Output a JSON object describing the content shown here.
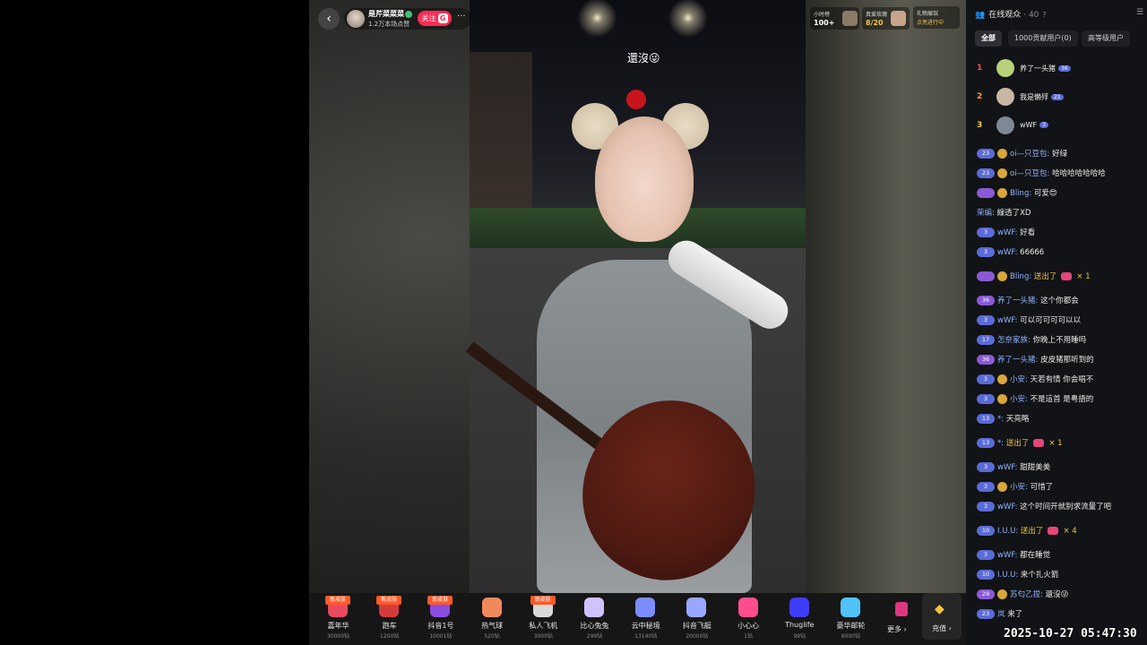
{
  "host": {
    "name": "是芹菜菜菜",
    "subtitle": "1.2万本场点赞",
    "follow_label": "关注",
    "follow_badge": "G",
    "more": "···",
    "back": "‹"
  },
  "video": {
    "sign_text": "還沒😜"
  },
  "top_rank": {
    "hour_label": "小时榜",
    "hour_value": "100+",
    "fan_label": "真爱玫瑰",
    "fan_value": "8/20",
    "gift_label": "礼物展馆",
    "gift_status": "点亮进行中"
  },
  "gifts": [
    {
      "badge": "新皮肤",
      "name": "嘉年华",
      "price": "30000钻",
      "color": "#e84a5f"
    },
    {
      "badge": "新皮肤",
      "name": "跑车",
      "price": "1200钻",
      "color": "#d43c3c"
    },
    {
      "badge": "新皮肤",
      "name": "抖音1号",
      "price": "10001钻",
      "color": "#8a4de0"
    },
    {
      "badge": "",
      "name": "热气球",
      "price": "520钻",
      "color": "#f08a5d"
    },
    {
      "badge": "新皮肤",
      "name": "私人飞机",
      "price": "3000钻",
      "color": "#d9d9d9"
    },
    {
      "badge": "",
      "name": "比心兔兔",
      "price": "299钻",
      "color": "#cfc2ff"
    },
    {
      "badge": "",
      "name": "云中秘境",
      "price": "13140钻",
      "color": "#7d8cff"
    },
    {
      "badge": "",
      "name": "抖音飞艇",
      "price": "20000钻",
      "color": "#9aa7ff"
    },
    {
      "badge": "",
      "name": "小心心",
      "price": "1钻",
      "color": "#ff4d8d"
    },
    {
      "badge": "",
      "name": "Thuglife",
      "price": "99钻",
      "color": "#3d3dff"
    },
    {
      "badge": "",
      "name": "豪华邮轮",
      "price": "6000钻",
      "color": "#4fc3f7"
    }
  ],
  "gift_more_label": "更多 ›",
  "recharge_label": "充值 ›",
  "panel": {
    "title": "在线观众",
    "count": "· 40",
    "help": "?",
    "tabs": [
      "全部",
      "1000贡献用户(0)",
      "高等级用户"
    ],
    "top_users": [
      {
        "rank": "1",
        "name": "养了一头猪",
        "level": "36",
        "rank_color": "#ff4d4d",
        "avatar": "#b9d27a"
      },
      {
        "rank": "2",
        "name": "我是懒殍",
        "level": "21",
        "rank_color": "#ff9d3a",
        "avatar": "#c9b6a3"
      },
      {
        "rank": "3",
        "name": "wWF",
        "level": "3",
        "rank_color": "#f5d04a",
        "avatar": "#7d8a96"
      }
    ]
  },
  "chat": [
    {
      "level": "23",
      "fan": true,
      "nick": "oi—只豆包:",
      "text": "好绿"
    },
    {
      "level": "23",
      "fan": true,
      "nick": "oi—只豆包:",
      "text": "哈哈哈哈哈哈哈"
    },
    {
      "level": "",
      "fan": true,
      "purple": true,
      "nick": "Bling:",
      "text": "可爱😍"
    },
    {
      "level": "",
      "fan": false,
      "nick": "荣编:",
      "text": "線透了XD"
    },
    {
      "level": "3",
      "fan": false,
      "nick": "wWF:",
      "text": "好看"
    },
    {
      "level": "3",
      "fan": false,
      "nick": "wWF:",
      "text": "66666"
    },
    {
      "level": "",
      "fan": true,
      "purple": true,
      "nick": "Bling:",
      "gift": "送出了",
      "count": "× 1"
    },
    {
      "level": "36",
      "fan": false,
      "purple": true,
      "nick": "养了一头猪:",
      "text": "这个你都会"
    },
    {
      "level": "3",
      "fan": false,
      "nick": "wWF:",
      "text": "可以可可可可以以"
    },
    {
      "level": "17",
      "fan": false,
      "nick": "怎奈家族:",
      "text": "你晚上不用睡吗"
    },
    {
      "level": "36",
      "fan": false,
      "purple": true,
      "nick": "养了一头猪:",
      "text": "皮皮猪那听到的"
    },
    {
      "level": "3",
      "fan": true,
      "nick": "小安:",
      "text": "天若有情 你会唱不"
    },
    {
      "level": "3",
      "fan": true,
      "nick": "小安:",
      "text": "不是這首 是粤語的"
    },
    {
      "level": "13",
      "fan": false,
      "nick": "*:",
      "text": "天亮略"
    },
    {
      "level": "13",
      "fan": false,
      "nick": "*:",
      "gift": "送出了",
      "count": "× 1"
    },
    {
      "level": "3",
      "fan": false,
      "nick": "wWF:",
      "text": "甜甜美美"
    },
    {
      "level": "3",
      "fan": true,
      "nick": "小安:",
      "text": "可惜了"
    },
    {
      "level": "3",
      "fan": false,
      "nick": "wWF:",
      "text": "这个时间开就别求流量了吧"
    },
    {
      "level": "10",
      "fan": false,
      "nick": "I.U.U:",
      "gift": "送出了",
      "count": "× 4"
    },
    {
      "level": "3",
      "fan": false,
      "nick": "wWF:",
      "text": "都在睡觉"
    },
    {
      "level": "10",
      "fan": false,
      "nick": "I.U.U:",
      "text": "来个扎火箭"
    },
    {
      "level": "29",
      "fan": true,
      "purple": true,
      "nick": "苏匂乙捏:",
      "text": "還沒😜"
    },
    {
      "level": "23",
      "fan": false,
      "nick": "岚",
      "text": "来了"
    }
  ],
  "timestamp": "2025-10-27 05:47:30"
}
